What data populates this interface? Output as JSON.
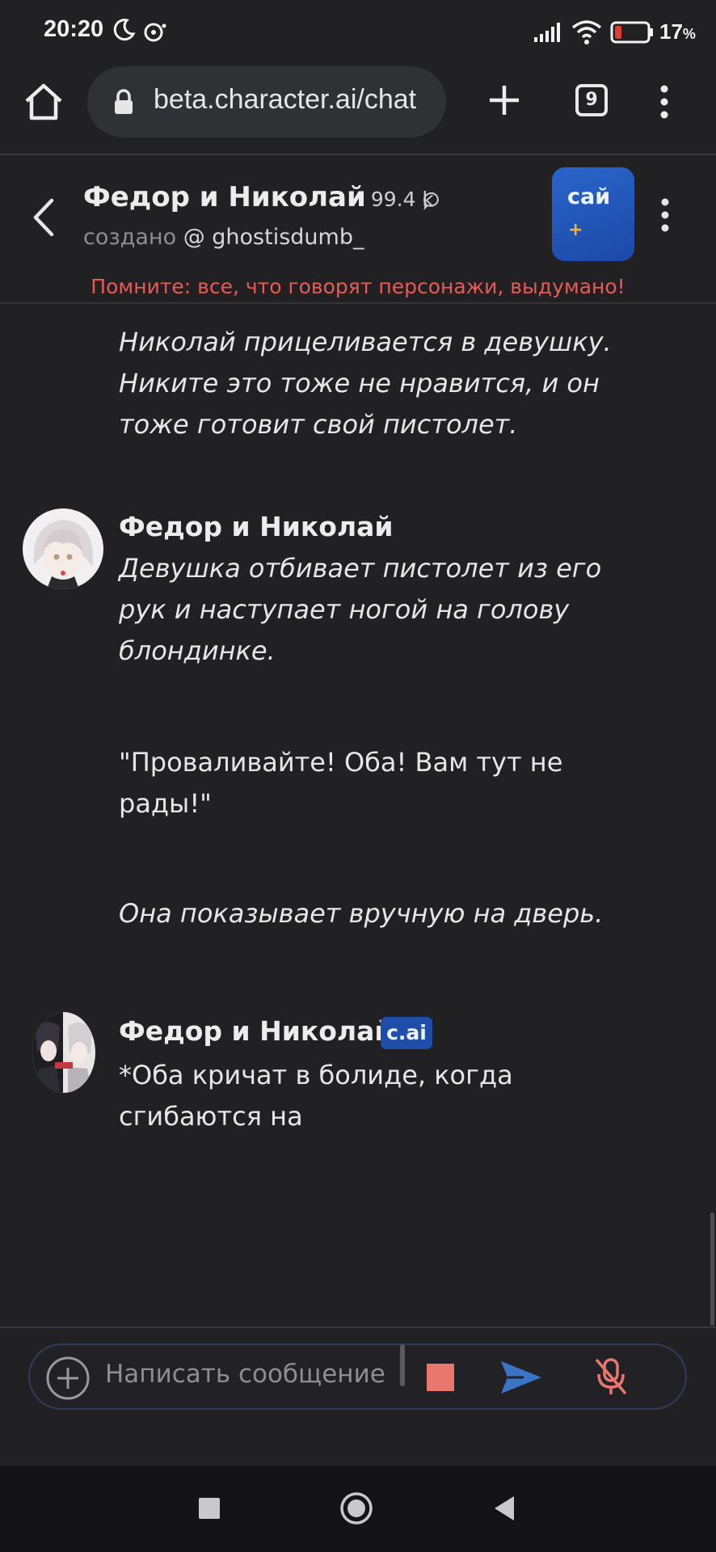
{
  "status_bar": {
    "time": "20:20",
    "battery": "17",
    "battery_unit": "%"
  },
  "browser": {
    "url": "beta.character.ai/chat",
    "tab_count": "9"
  },
  "header": {
    "name": "Федор и Николай",
    "chat_count": "99.4 k",
    "creator_label": "создано",
    "creator_user": "@ ghostisdumb_",
    "plus_label": "сай",
    "plus_sign": "+",
    "disclaimer": "Помните: все, что говорят персонажи, выдумано!"
  },
  "messages": [
    {
      "text": "Николай прицеливается в девушку. Никите это тоже не нравится, и он тоже готовит свой пистолет."
    },
    {
      "sender": "Федор и Николай",
      "part1": "Девушка отбивает пистолет из его рук и наступает ногой на голову блондинке.",
      "part2": "\"Проваливайте! Оба! Вам тут не рады!\"",
      "part3": "Она показывает вручную на дверь."
    },
    {
      "sender": "Федор и Николай",
      "badge": "c.ai",
      "text": "*Оба кричат в болиде, когда сгибаются на"
    }
  ],
  "composer": {
    "placeholder": "Написать сообщение"
  },
  "colors": {
    "stop": "#e8776e",
    "send": "#3b73c7",
    "mic_muted": "#e8776e",
    "disclaimer": "#ea5a55",
    "plus_badge": "#2a65c9"
  }
}
